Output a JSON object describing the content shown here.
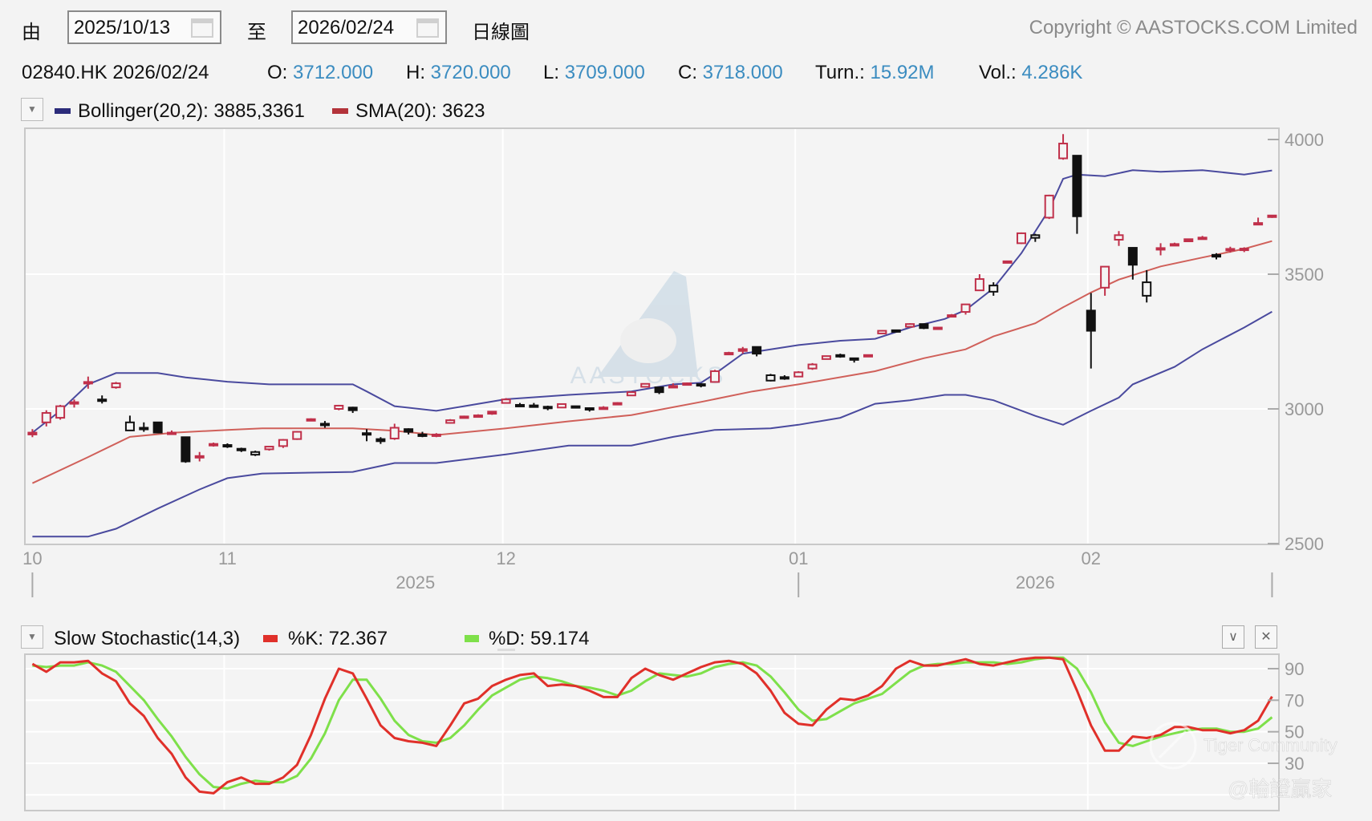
{
  "header": {
    "from_label": "由",
    "from_date": "2025/10/13",
    "to_label": "至",
    "to_date": "2026/02/24",
    "chart_type": "日線圖",
    "copyright": "Copyright © AASTOCKS.COM Limited"
  },
  "quote": {
    "symbol_date": "02840.HK 2026/02/24",
    "open_label": "O:",
    "open": "3712.000",
    "high_label": "H:",
    "high": "3720.000",
    "low_label": "L:",
    "low": "3709.000",
    "close_label": "C:",
    "close": "3718.000",
    "turn_label": "Turn.:",
    "turnover": "15.92M",
    "vol_label": "Vol.:",
    "volume": "4.286K"
  },
  "main_legend": {
    "bollinger": "Bollinger(20,2): 3885,3361",
    "sma": "SMA(20): 3623"
  },
  "stoch_legend": {
    "title": "Slow Stochastic(14,3)",
    "k": "%K: 72.367",
    "d": "%D: 59.174"
  },
  "colors": {
    "up": "#c0304a",
    "down": "#111111",
    "bollinger": "#4a4a9e",
    "sma": "#d0605a",
    "k_line": "#e0302a",
    "d_line": "#7ee04a",
    "quote_value": "#3b8cc0"
  },
  "watermarks": {
    "logo": "AASTOCKS",
    "community": "Tiger Community",
    "handle": "@輪證贏家"
  },
  "icons": {
    "dropdown": "triangle-down-icon",
    "calendar": "calendar-icon",
    "collapse": "chevron-down-icon",
    "close": "close-icon"
  },
  "chart_data": [
    {
      "type": "candlestick",
      "title": "02840.HK daily",
      "x_tick_labels": [
        {
          "i": 0,
          "label": "10"
        },
        {
          "i": 14,
          "label": "11"
        },
        {
          "i": 34,
          "label": "12"
        },
        {
          "i": 55,
          "label": "01"
        },
        {
          "i": 76,
          "label": "02"
        }
      ],
      "year_labels": [
        {
          "i": 27.5,
          "label": "2025"
        },
        {
          "i": 72,
          "label": "2026"
        }
      ],
      "y_ticks": [
        "4000",
        "3500",
        "3000",
        "2500"
      ],
      "ylim": [
        2500,
        4000
      ],
      "ohlc": [
        [
          2905,
          2925,
          2895,
          2912
        ],
        [
          2950,
          2995,
          2935,
          2985
        ],
        [
          2967,
          3015,
          2960,
          3010
        ],
        [
          3020,
          3035,
          3005,
          3025
        ],
        [
          3095,
          3120,
          3075,
          3100
        ],
        [
          3035,
          3050,
          3020,
          3035
        ],
        [
          3080,
          3100,
          3075,
          3095
        ],
        [
          2920,
          2975,
          2918,
          2950
        ],
        [
          2930,
          2950,
          2915,
          2930
        ],
        [
          2950,
          2952,
          2910,
          2912
        ],
        [
          2912,
          2920,
          2905,
          2912
        ],
        [
          2895,
          2897,
          2800,
          2805
        ],
        [
          2825,
          2840,
          2805,
          2825
        ],
        [
          2868,
          2875,
          2860,
          2870
        ],
        [
          2860,
          2872,
          2855,
          2866
        ],
        [
          2852,
          2856,
          2840,
          2850
        ],
        [
          2830,
          2845,
          2825,
          2840
        ],
        [
          2850,
          2862,
          2845,
          2860
        ],
        [
          2862,
          2888,
          2855,
          2885
        ],
        [
          2888,
          2918,
          2885,
          2915
        ],
        [
          2960,
          2965,
          2955,
          2962
        ],
        [
          2945,
          2955,
          2930,
          2945
        ],
        [
          3000,
          3015,
          2995,
          3012
        ],
        [
          3005,
          3008,
          2985,
          2995
        ],
        [
          2910,
          2925,
          2880,
          2910
        ],
        [
          2888,
          2895,
          2870,
          2880
        ],
        [
          2890,
          2945,
          2885,
          2930
        ],
        [
          2925,
          2928,
          2905,
          2915
        ],
        [
          2905,
          2915,
          2895,
          2902
        ],
        [
          2900,
          2910,
          2895,
          2905
        ],
        [
          2948,
          2962,
          2945,
          2958
        ],
        [
          2970,
          2975,
          2965,
          2972
        ],
        [
          2975,
          2980,
          2968,
          2976
        ],
        [
          2990,
          2992,
          2978,
          2982
        ],
        [
          3022,
          3040,
          3020,
          3035
        ],
        [
          3015,
          3022,
          3010,
          3015
        ],
        [
          3013,
          3022,
          3005,
          3013
        ],
        [
          3008,
          3012,
          2995,
          3005
        ],
        [
          3005,
          3020,
          3003,
          3018
        ],
        [
          3010,
          3012,
          3005,
          3008
        ],
        [
          3003,
          3006,
          2990,
          3000
        ],
        [
          3000,
          3010,
          2998,
          3005
        ],
        [
          3018,
          3025,
          3015,
          3022
        ],
        [
          3050,
          3065,
          3048,
          3062
        ],
        [
          3082,
          3095,
          3080,
          3093
        ],
        [
          3080,
          3082,
          3055,
          3062
        ],
        [
          3082,
          3095,
          3080,
          3085
        ],
        [
          3092,
          3098,
          3090,
          3095
        ],
        [
          3092,
          3095,
          3080,
          3090
        ],
        [
          3100,
          3145,
          3098,
          3140
        ],
        [
          3205,
          3212,
          3200,
          3208
        ],
        [
          3215,
          3230,
          3205,
          3222
        ],
        [
          3230,
          3232,
          3195,
          3205
        ],
        [
          3105,
          3130,
          3102,
          3125
        ],
        [
          3115,
          3125,
          3108,
          3118
        ],
        [
          3120,
          3140,
          3118,
          3136
        ],
        [
          3150,
          3170,
          3145,
          3165
        ],
        [
          3185,
          3198,
          3183,
          3196
        ],
        [
          3200,
          3205,
          3190,
          3194
        ],
        [
          3188,
          3190,
          3172,
          3182
        ],
        [
          3196,
          3202,
          3194,
          3200
        ],
        [
          3280,
          3292,
          3278,
          3290
        ],
        [
          3292,
          3294,
          3286,
          3288
        ],
        [
          3305,
          3318,
          3303,
          3315
        ],
        [
          3315,
          3316,
          3296,
          3300
        ],
        [
          3300,
          3304,
          3298,
          3302
        ],
        [
          3345,
          3352,
          3342,
          3348
        ],
        [
          3360,
          3390,
          3350,
          3388
        ],
        [
          3440,
          3500,
          3438,
          3482
        ],
        [
          3435,
          3470,
          3420,
          3458
        ],
        [
          3545,
          3550,
          3540,
          3548
        ],
        [
          3615,
          3655,
          3612,
          3652
        ],
        [
          3635,
          3650,
          3620,
          3645
        ],
        [
          3710,
          3795,
          3705,
          3792
        ],
        [
          3930,
          4020,
          3925,
          3985
        ],
        [
          3940,
          3942,
          3650,
          3715
        ],
        [
          3365,
          3430,
          3150,
          3290
        ],
        [
          3450,
          3530,
          3420,
          3528
        ],
        [
          3628,
          3660,
          3605,
          3645
        ],
        [
          3598,
          3600,
          3480,
          3535
        ],
        [
          3420,
          3515,
          3395,
          3470
        ],
        [
          3595,
          3615,
          3570,
          3597
        ],
        [
          3610,
          3617,
          3605,
          3612
        ],
        [
          3622,
          3632,
          3620,
          3630
        ],
        [
          3635,
          3642,
          3630,
          3636
        ],
        [
          3565,
          3578,
          3555,
          3572
        ],
        [
          3590,
          3602,
          3580,
          3594
        ],
        [
          3590,
          3600,
          3582,
          3595
        ],
        [
          3685,
          3710,
          3683,
          3690
        ],
        [
          3712,
          3720,
          3709,
          3718
        ]
      ],
      "series": [
        {
          "name": "Bollinger upper",
          "points": [
            [
              0,
              2912
            ],
            [
              2,
              2993
            ],
            [
              4,
              3091
            ],
            [
              6,
              3133
            ],
            [
              9,
              3133
            ],
            [
              11,
              3117
            ],
            [
              14,
              3101
            ],
            [
              17,
              3091
            ],
            [
              23,
              3091
            ],
            [
              24,
              3065
            ],
            [
              26,
              3010
            ],
            [
              29,
              2993
            ],
            [
              31,
              3010
            ],
            [
              34,
              3036
            ],
            [
              38.5,
              3052
            ],
            [
              43,
              3065
            ],
            [
              46,
              3091
            ],
            [
              48,
              3097
            ],
            [
              49,
              3130
            ],
            [
              51,
              3205
            ],
            [
              53,
              3221
            ],
            [
              55,
              3237
            ],
            [
              58,
              3253
            ],
            [
              60.5,
              3260
            ],
            [
              63,
              3302
            ],
            [
              65.5,
              3334
            ],
            [
              67,
              3367
            ],
            [
              69,
              3448
            ],
            [
              71,
              3578
            ],
            [
              73,
              3740
            ],
            [
              74,
              3854
            ],
            [
              75,
              3870
            ],
            [
              77,
              3864
            ],
            [
              79,
              3886
            ],
            [
              81,
              3880
            ],
            [
              84,
              3886
            ],
            [
              87,
              3870
            ],
            [
              89,
              3885
            ]
          ]
        },
        {
          "name": "SMA(20)",
          "points": [
            [
              0,
              2724
            ],
            [
              4,
              2821
            ],
            [
              7,
              2896
            ],
            [
              10.2,
              2912
            ],
            [
              14,
              2922
            ],
            [
              16.5,
              2928
            ],
            [
              23,
              2928
            ],
            [
              26,
              2919
            ],
            [
              29,
              2903
            ],
            [
              34,
              2928
            ],
            [
              38.5,
              2954
            ],
            [
              43,
              2977
            ],
            [
              48,
              3026
            ],
            [
              51.7,
              3065
            ],
            [
              55,
              3091
            ],
            [
              60.5,
              3140
            ],
            [
              64,
              3188
            ],
            [
              67,
              3221
            ],
            [
              69,
              3269
            ],
            [
              72,
              3318
            ],
            [
              74,
              3377
            ],
            [
              76,
              3432
            ],
            [
              78,
              3480
            ],
            [
              81,
              3529
            ],
            [
              84,
              3562
            ],
            [
              87,
              3594
            ],
            [
              89,
              3623
            ]
          ]
        },
        {
          "name": "Bollinger lower",
          "points": [
            [
              0,
              2526
            ],
            [
              4,
              2526
            ],
            [
              6,
              2555
            ],
            [
              9,
              2630
            ],
            [
              12,
              2701
            ],
            [
              14,
              2743
            ],
            [
              16.5,
              2760
            ],
            [
              23,
              2766
            ],
            [
              26,
              2799
            ],
            [
              29,
              2799
            ],
            [
              34,
              2831
            ],
            [
              38.5,
              2864
            ],
            [
              43,
              2864
            ],
            [
              46,
              2896
            ],
            [
              49,
              2922
            ],
            [
              53,
              2928
            ],
            [
              55,
              2941
            ],
            [
              58,
              2967
            ],
            [
              60.5,
              3019
            ],
            [
              63,
              3032
            ],
            [
              65.5,
              3052
            ],
            [
              67,
              3052
            ],
            [
              69,
              3032
            ],
            [
              72,
              2974
            ],
            [
              74,
              2941
            ],
            [
              76,
              2993
            ],
            [
              78,
              3042
            ],
            [
              79,
              3091
            ],
            [
              82,
              3156
            ],
            [
              84,
              3221
            ],
            [
              87,
              3302
            ],
            [
              89,
              3361
            ]
          ]
        }
      ]
    },
    {
      "type": "line",
      "title": "Slow Stochastic(14,3)",
      "y_ticks": [
        "90",
        "70",
        "50",
        "30"
      ],
      "ylim": [
        0,
        100
      ],
      "series": [
        {
          "name": "%K",
          "values": [
            93,
            88,
            94,
            94,
            95,
            87,
            82,
            68,
            60,
            46,
            36,
            21,
            12,
            11,
            18,
            21,
            17,
            17,
            21,
            29,
            48,
            71,
            90,
            87,
            71,
            54,
            46,
            44,
            43,
            41,
            54,
            68,
            71,
            79,
            83,
            86,
            87,
            79,
            80,
            79,
            76,
            72,
            72,
            84,
            90,
            86,
            83,
            87,
            91,
            94,
            95,
            93,
            87,
            76,
            62,
            55,
            54,
            64,
            71,
            70,
            73,
            79,
            90,
            95,
            92,
            92,
            94,
            96,
            93,
            92,
            94,
            96,
            97,
            97,
            96,
            76,
            54,
            38,
            38,
            47,
            46,
            48,
            53,
            53,
            51,
            51,
            49,
            51,
            57,
            72.367
          ]
        },
        {
          "name": "%D",
          "values": [
            92,
            91,
            92,
            92,
            94,
            92,
            88,
            79,
            70,
            58,
            47,
            34,
            23,
            15,
            14,
            17,
            19,
            18,
            18,
            22,
            33,
            49,
            70,
            83,
            83,
            71,
            57,
            48,
            44,
            43,
            46,
            54,
            64,
            73,
            78,
            83,
            85,
            84,
            82,
            79,
            78,
            76,
            73,
            76,
            82,
            87,
            86,
            85,
            87,
            91,
            93,
            94,
            92,
            85,
            75,
            64,
            57,
            58,
            63,
            68,
            71,
            74,
            81,
            88,
            92,
            93,
            93,
            94,
            94,
            94,
            93,
            94,
            96,
            97,
            97,
            90,
            75,
            56,
            43,
            41,
            44,
            47,
            49,
            51,
            52,
            52,
            50,
            50,
            52,
            59.174
          ]
        }
      ]
    }
  ]
}
